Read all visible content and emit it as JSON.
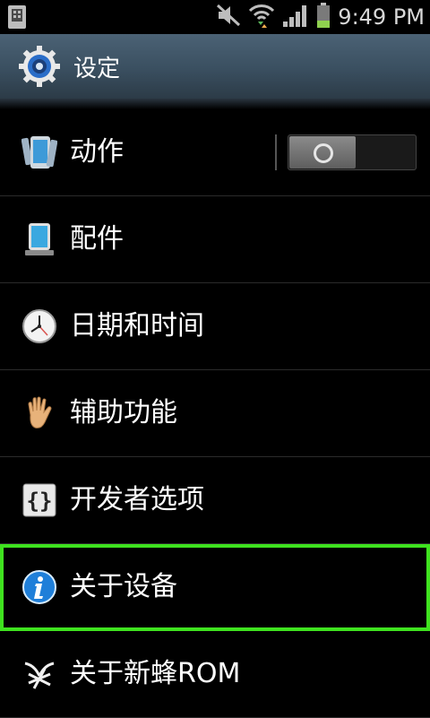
{
  "status": {
    "time": "9:49 PM"
  },
  "header": {
    "title": "设定"
  },
  "settings": {
    "items": [
      {
        "label": "动作",
        "icon": "motion-icon"
      },
      {
        "label": "配件",
        "icon": "accessory-icon"
      },
      {
        "label": "日期和时间",
        "icon": "clock-icon"
      },
      {
        "label": "辅助功能",
        "icon": "hand-icon"
      },
      {
        "label": "开发者选项",
        "icon": "braces-icon"
      },
      {
        "label": "关于设备",
        "icon": "info-icon"
      },
      {
        "label": "关于新蜂ROM",
        "icon": "bee-logo-icon"
      }
    ],
    "motion_toggle": {
      "state": "off"
    },
    "selected_item": "关于设备"
  },
  "colors": {
    "selection": "#3fe21f",
    "titlebar": "#3a4f60"
  }
}
